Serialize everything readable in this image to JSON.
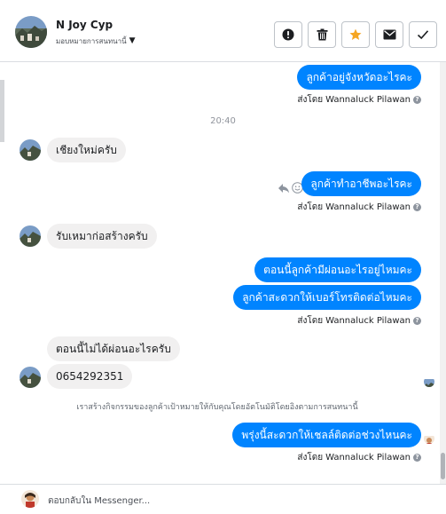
{
  "header": {
    "contact_name": "N Joy Cyp",
    "assign_label": "มอบหมายการสนทนานี้",
    "assign_caret": "▼",
    "buttons": [
      {
        "name": "mark-spam-button",
        "icon": "alert-circle-icon"
      },
      {
        "name": "delete-button",
        "icon": "trash-icon"
      },
      {
        "name": "star-button",
        "icon": "star-icon"
      },
      {
        "name": "mark-unread-button",
        "icon": "envelope-icon"
      },
      {
        "name": "mark-done-button",
        "icon": "checkmark-icon"
      }
    ]
  },
  "thread": {
    "msg1": "ลูกค้าอยู่จังหวัดอะไรคะ",
    "sent_by_prefix": "ส่งโดย",
    "agent_name": "Wannaluck Pilawan",
    "help_glyph": "?",
    "time": "20:40",
    "msg2": "เชียงใหม่ครับ",
    "msg3": "ลูกค้าทำอาชีพอะไรคะ",
    "msg4": "รับเหมาก่อสร้างครับ",
    "msg5": "ตอนนี้ลูกค้ามีผ่อนอะไรอยู่ไหมคะ",
    "msg6": "ลูกค้าสะดวกให้เบอร์โทรติดต่อไหมคะ",
    "msg7": "ตอนนี้ไม่ได้ผ่อนอะไรครับ",
    "msg8": "0654292351",
    "system_note": "เราสร้างกิจกรรมของลูกค้าเป้าหมายให้กับคุณโดยอัตโนมัติโดยอิงตามการสนทนานี้",
    "msg9": "พรุ่งนี้สะดวกให้เชลล์ติดต่อช่วงไหนคะ"
  },
  "composer": {
    "placeholder": "ตอบกลับใน Messenger..."
  },
  "colors": {
    "outgoing": "#0084ff",
    "incoming": "#f1f0f0",
    "star": "#f5a623"
  }
}
